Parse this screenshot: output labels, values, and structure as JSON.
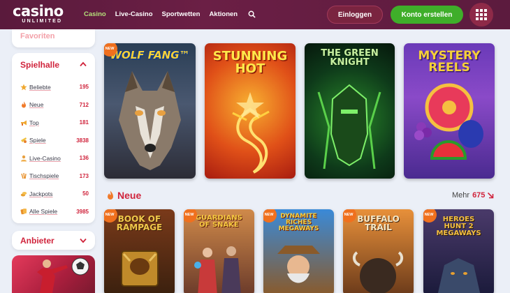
{
  "header": {
    "logo_main": "casino",
    "logo_sub": "UNLIMITED",
    "nav": [
      "Casino",
      "Live-Casino",
      "Sportwetten",
      "Aktionen"
    ],
    "login_label": "Einloggen",
    "register_label": "Konto erstellen"
  },
  "sidebar": {
    "favorites_label": "Favoriten",
    "hall_title": "Spielhalle",
    "items": [
      {
        "label": "Beliebte",
        "count": "195",
        "icon": "star-icon"
      },
      {
        "label": "Neue",
        "count": "712",
        "icon": "flame-icon"
      },
      {
        "label": "Top",
        "count": "181",
        "icon": "megaphone-icon"
      },
      {
        "label": "Spiele",
        "count": "3838",
        "icon": "slot-icon"
      },
      {
        "label": "Live-Casino",
        "count": "136",
        "icon": "dealer-icon"
      },
      {
        "label": "Tischspiele",
        "count": "173",
        "icon": "table-icon"
      },
      {
        "label": "Jackpots",
        "count": "50",
        "icon": "coins-icon"
      },
      {
        "label": "Alle Spiele",
        "count": "3985",
        "icon": "cards-icon"
      }
    ],
    "provider_title": "Anbieter"
  },
  "games_top": [
    {
      "title": "WOLF FANG™"
    },
    {
      "title": "STUNNING HOT"
    },
    {
      "title": "THE GREEN KNIGHT"
    },
    {
      "title": "MYSTERY REELS"
    }
  ],
  "section": {
    "title": "Neue",
    "more_label": "Mehr",
    "more_count": "675"
  },
  "games_new": [
    {
      "title": "BOOK OF RAMPAGE"
    },
    {
      "title": "GUARDIANS OF SNAKE"
    },
    {
      "title": "DYNAMITE RICHES MEGAWAYS"
    },
    {
      "title": "BUFFALO TRAIL"
    },
    {
      "title": "HEROES HUNT 2 MEGAWAYS"
    }
  ],
  "badges": {
    "new": "NEW"
  },
  "colors": {
    "accent": "#d0243c",
    "header": "#5a1a3c",
    "primary_button": "#3fae2a",
    "nav_active": "#b4e07a"
  }
}
